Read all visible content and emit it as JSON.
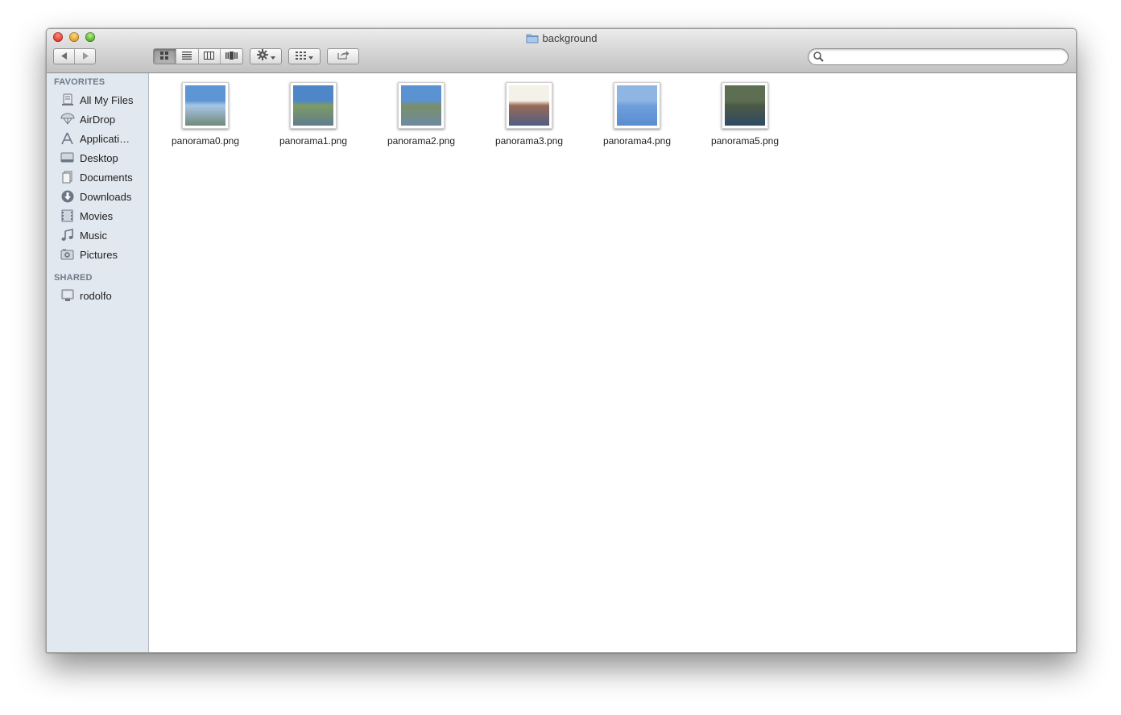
{
  "window": {
    "title": "background"
  },
  "toolbar": {
    "back_icon": "back-arrow-icon",
    "forward_icon": "forward-arrow-icon",
    "view_modes": [
      "icon-view",
      "list-view",
      "column-view",
      "cover-flow-view"
    ],
    "active_view": "icon-view",
    "action_icon": "gear-icon",
    "arrange_icon": "arrange-grid-icon",
    "share_icon": "share-icon",
    "search_placeholder": ""
  },
  "sidebar": {
    "favorites_header": "FAVORITES",
    "favorites": [
      {
        "label": "All My Files",
        "icon": "all-files-icon"
      },
      {
        "label": "AirDrop",
        "icon": "airdrop-icon"
      },
      {
        "label": "Applicati…",
        "icon": "applications-icon"
      },
      {
        "label": "Desktop",
        "icon": "desktop-icon"
      },
      {
        "label": "Documents",
        "icon": "documents-icon"
      },
      {
        "label": "Downloads",
        "icon": "downloads-icon"
      },
      {
        "label": "Movies",
        "icon": "movies-icon"
      },
      {
        "label": "Music",
        "icon": "music-icon"
      },
      {
        "label": "Pictures",
        "icon": "pictures-icon"
      }
    ],
    "shared_header": "SHARED",
    "shared": [
      {
        "label": "rodolfo",
        "icon": "computer-icon"
      }
    ]
  },
  "files": [
    {
      "name": "panorama0.png",
      "colors": [
        "#5e95d4",
        "#a8c6e6",
        "#6f8a7a"
      ]
    },
    {
      "name": "panorama1.png",
      "colors": [
        "#4f86c8",
        "#7e9b64",
        "#5f7c8f"
      ]
    },
    {
      "name": "panorama2.png",
      "colors": [
        "#5b92d1",
        "#7a8f6a",
        "#6d8aa3"
      ]
    },
    {
      "name": "panorama3.png",
      "colors": [
        "#f4f1e8",
        "#9a6a55",
        "#4e5e86"
      ]
    },
    {
      "name": "panorama4.png",
      "colors": [
        "#8fb6e3",
        "#6f9fdb",
        "#5a8ccf"
      ]
    },
    {
      "name": "panorama5.png",
      "colors": [
        "#5d6e52",
        "#4b5a44",
        "#2f4a66"
      ]
    }
  ],
  "colors": {
    "sidebar_bg": "#e2e8ef",
    "section_header": "#6e7b8b",
    "titlebar_top": "#ececec",
    "titlebar_bottom": "#c2c2c2"
  }
}
